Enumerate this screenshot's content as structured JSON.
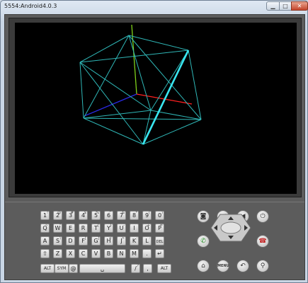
{
  "window": {
    "title": "5554:Android4.0.3",
    "minimize_icon": "minimize-icon",
    "maximize_icon": "maximize-icon",
    "close_icon": "close-icon"
  },
  "screen": {
    "scene": "3D wireframe cube with XYZ axes",
    "colors": {
      "wireframe": "#2fb7b7",
      "highlight_edge": "#39e6f0",
      "axis_x": "#ff2020",
      "axis_y": "#7fd11a",
      "axis_z": "#2020e0",
      "background": "#000000"
    }
  },
  "keyboard": {
    "rows": [
      [
        {
          "label": "1",
          "sup": "!"
        },
        {
          "label": "2",
          "sup": "@"
        },
        {
          "label": "3",
          "sup": "#"
        },
        {
          "label": "4",
          "sup": "$"
        },
        {
          "label": "5",
          "sup": "%"
        },
        {
          "label": "6",
          "sup": "^"
        },
        {
          "label": "7",
          "sup": "&"
        },
        {
          "label": "8",
          "sup": "*"
        },
        {
          "label": "9",
          "sup": "("
        },
        {
          "label": "0",
          "sup": ")"
        }
      ],
      [
        {
          "label": "Q",
          "sup": "~"
        },
        {
          "label": "W",
          "sup": "\""
        },
        {
          "label": "E",
          "sup": ""
        },
        {
          "label": "R",
          "sup": ""
        },
        {
          "label": "T",
          "sup": "{"
        },
        {
          "label": "Y",
          "sup": "}"
        },
        {
          "label": "U",
          "sup": "-"
        },
        {
          "label": "I",
          "sup": ""
        },
        {
          "label": "O",
          "sup": "+"
        },
        {
          "label": "P",
          "sup": "="
        }
      ],
      [
        {
          "label": "A",
          "sup": ""
        },
        {
          "label": "S",
          "sup": "\\"
        },
        {
          "label": "D",
          "sup": ""
        },
        {
          "label": "F",
          "sup": "["
        },
        {
          "label": "G",
          "sup": "]"
        },
        {
          "label": "H",
          "sup": "<"
        },
        {
          "label": "J",
          "sup": ">"
        },
        {
          "label": "K",
          "sup": ";"
        },
        {
          "label": "L",
          "sup": ":"
        },
        {
          "label": "DEL",
          "sup": ""
        }
      ],
      [
        {
          "label": "⇧",
          "sup": ""
        },
        {
          "label": "Z",
          "sup": ""
        },
        {
          "label": "X",
          "sup": ""
        },
        {
          "label": "C",
          "sup": ""
        },
        {
          "label": "V",
          "sup": ""
        },
        {
          "label": "B",
          "sup": ""
        },
        {
          "label": "N",
          "sup": ""
        },
        {
          "label": "M",
          "sup": ""
        },
        {
          "label": ".",
          "sup": ""
        },
        {
          "label": "↵",
          "sup": ""
        }
      ]
    ],
    "bottom": {
      "alt_left": "ALT",
      "sym": "SYM",
      "at": "@",
      "space": "␣",
      "slash": "/",
      "question": "?",
      "comma": ",",
      "alt_right": "ALT"
    }
  },
  "controls": {
    "camera_icon": "camera-icon",
    "volume_down_icon": "volume-down-icon",
    "volume_up_icon": "volume-up-icon",
    "power_icon": "power-icon",
    "call_icon": "call-icon",
    "end_call_icon": "end-call-icon",
    "home_icon": "home-icon",
    "menu_label": "MENU",
    "back_icon": "back-icon",
    "search_icon": "search-icon",
    "dpad": "directional-pad"
  }
}
